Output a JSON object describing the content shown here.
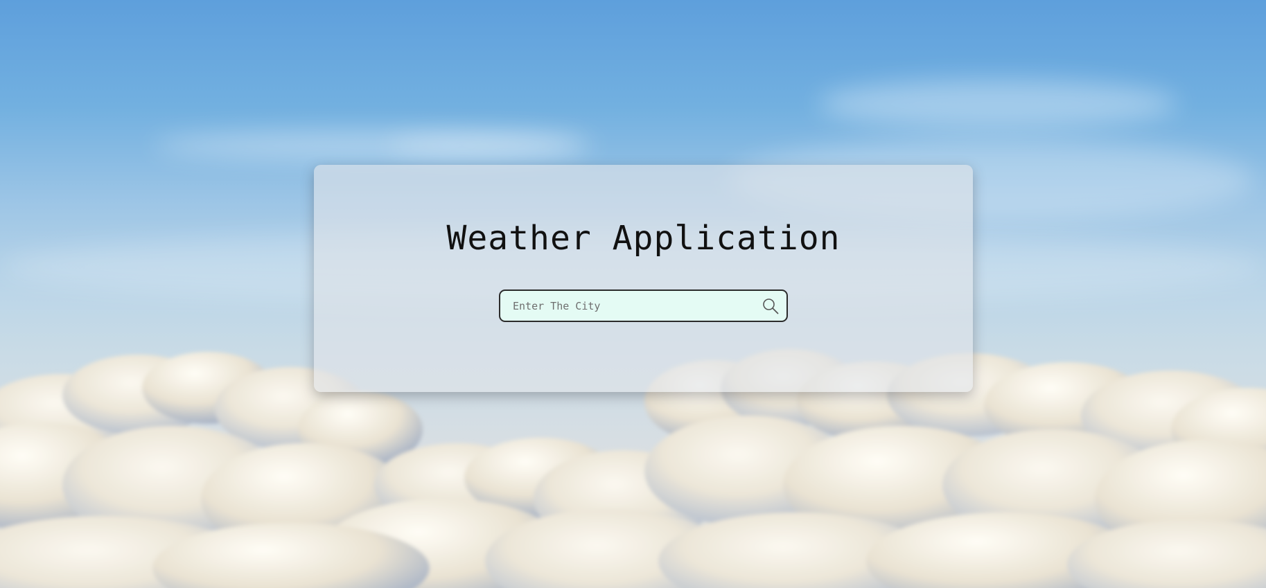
{
  "app": {
    "title": "Weather Application"
  },
  "search": {
    "placeholder": "Enter The City",
    "value": "",
    "icon": "search-icon"
  },
  "colors": {
    "card_bg": "#e1e4e8",
    "input_bg": "#e4fbf4",
    "input_border": "#2b2b2b",
    "title_text": "#111111"
  }
}
